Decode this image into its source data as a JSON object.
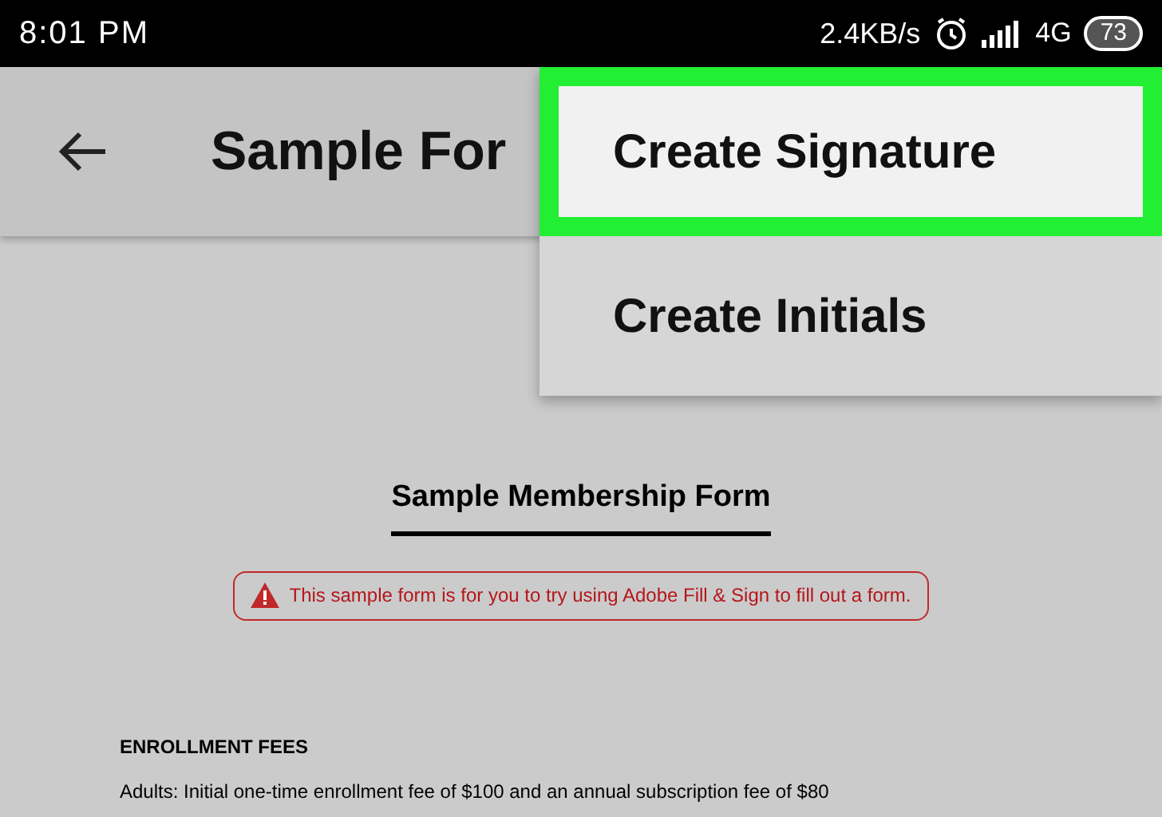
{
  "status_bar": {
    "time": "8:01 PM",
    "speed": "2.4KB/s",
    "network": "4G",
    "battery": "73"
  },
  "header": {
    "title": "Sample For"
  },
  "menu": [
    {
      "label": "Create Signature",
      "selected": true
    },
    {
      "label": "Create Initials",
      "selected": false
    }
  ],
  "document": {
    "title": "Sample Membership Form",
    "notice": "This sample form is for you to try using Adobe Fill & Sign to fill out a form.",
    "section": "ENROLLMENT FEES",
    "line": "Adults: Initial one-time enrollment fee of $100 and an annual subscription fee of $80"
  }
}
